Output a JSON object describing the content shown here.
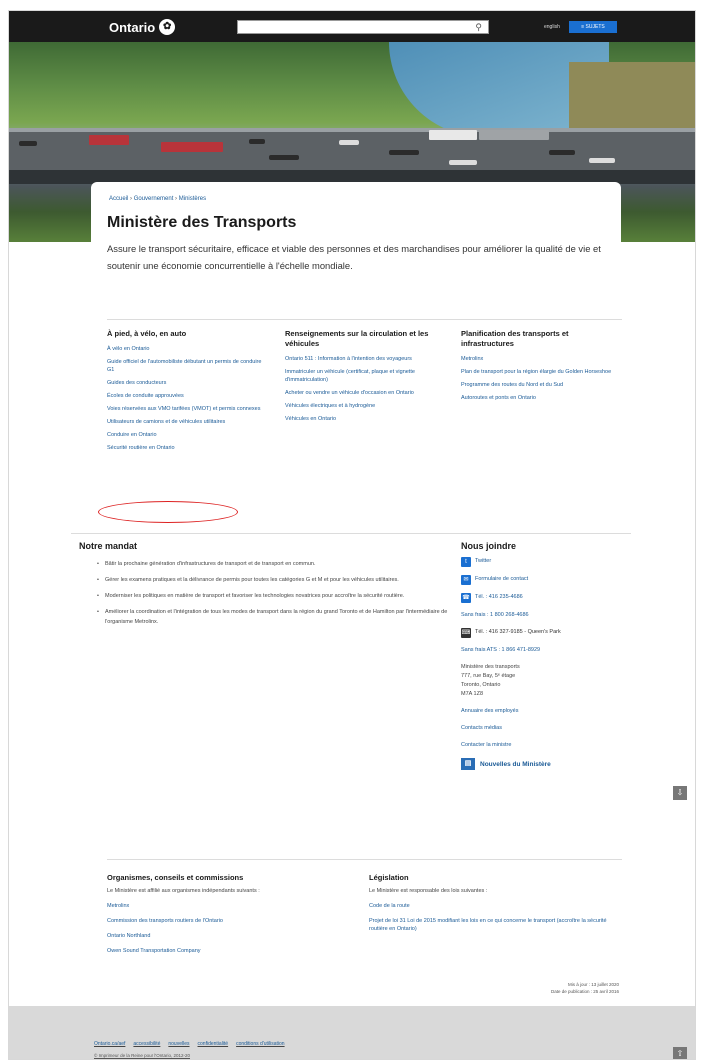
{
  "header": {
    "logo_text": "Ontario",
    "search_placeholder": "",
    "lang_label": "english",
    "menu_label": "≡ SUJETS"
  },
  "breadcrumb": [
    "Accueil",
    "Gouvernement",
    "Ministères"
  ],
  "page": {
    "title": "Ministère des Transports",
    "lead": "Assure le transport sécuritaire, efficace et viable des personnes et des marchandises pour améliorer la qualité de vie et soutenir une économie concurrentielle à l'échelle mondiale."
  },
  "columns": [
    {
      "heading": "À pied, à vélo, en auto",
      "links": [
        "À vélo en Ontario",
        "Guide officiel de l'automobiliste débutant un permis de conduire G1",
        "Guides des conducteurs",
        "Écoles de conduite approuvées",
        "Voies réservées aux VMO tarifées (VMOT) et permis connexes",
        "Utilisateurs de camions et de véhicules utilitaires",
        "Conduire en Ontario",
        "Sécurité routière en Ontario"
      ]
    },
    {
      "heading": "Renseignements sur la circulation et les véhicules",
      "links": [
        "Ontario 511 : Information à l'intention des voyageurs",
        "Immatriculer un véhicule (certificat, plaque et vignette d'immatriculation)",
        "Acheter ou vendre un véhicule d'occasion en Ontario",
        "Véhicules électriques et à hydrogène",
        "Véhicules en Ontario"
      ]
    },
    {
      "heading": "Planification des transports et infrastructures",
      "links": [
        "Metrolinx",
        "Plan de transport pour la région élargie du Golden Horseshoe",
        "Programme des routes du Nord et du Sud",
        "Autoroutes et ponts en Ontario"
      ]
    }
  ],
  "mandate": {
    "heading": "Notre mandat",
    "items": [
      "Bâtir la prochaine génération d'infrastructures de transport et de transport en commun.",
      "Gérer les examens pratiques et la délivrance de permis pour toutes les catégories G et M et pour les véhicules utilitaires.",
      "Moderniser les politiques en matière de transport et favoriser les technologies novatrices pour accroître la sécurité routière.",
      "Améliorer la coordination et l'intégration de tous les modes de transport dans la région du grand Toronto et de Hamilton par l'intermédiaire de l'organisme Metrolinx."
    ]
  },
  "contact": {
    "heading": "Nous joindre",
    "twitter": "Twitter",
    "form": "Formulaire de contact",
    "phone": "Tél. : 416 235-4686",
    "tollfree": "Sans frais : 1 800 268-4686",
    "tty": "Tél. : 416 327-9185 - Queen's Park",
    "tty_free": "Sans frais ATS : 1 866 471-8929",
    "address": [
      "Ministère des transports",
      "777, rue Bay, 5ᵉ étage",
      "Toronto, Ontario",
      "M7A 1Z8"
    ],
    "directory": "Annuaire des employés",
    "media": "Contacts médias",
    "minister": "Contacter la ministre",
    "news": "Nouvelles du Ministère"
  },
  "agencies": {
    "heading": "Organismes, conseils et commissions",
    "intro": "Le Ministère est affilié aux organismes indépendants suivants :",
    "links": [
      "Metrolinx",
      "Commission des transports routiers de l'Ontario",
      "Ontario Northland",
      "Owen Sound Transportation Company"
    ]
  },
  "legislation": {
    "heading": "Législation",
    "intro": "Le Ministère est responsable des lois suivantes :",
    "links": [
      "Code de la route",
      "Projet de loi 31 Loi de 2015 modifiant les lois en ce qui concerne le transport (accroître la sécurité routière en Ontario)"
    ]
  },
  "dates": {
    "updated": "Mis à jour : 13 juillet 2020",
    "published": "Date de publication : 25 avril 2016"
  },
  "footer": {
    "links": [
      "Ontario.ca/aef",
      "accessibilité",
      "nouvelles",
      "confidentialité",
      "conditions d'utilisation"
    ],
    "copyright": "© Imprimeur de la Reine pour l'Ontario, 2012-20"
  },
  "colors": {
    "accent": "#1a6fd1",
    "link": "#1a5a96",
    "highlight": "#dd2222"
  }
}
